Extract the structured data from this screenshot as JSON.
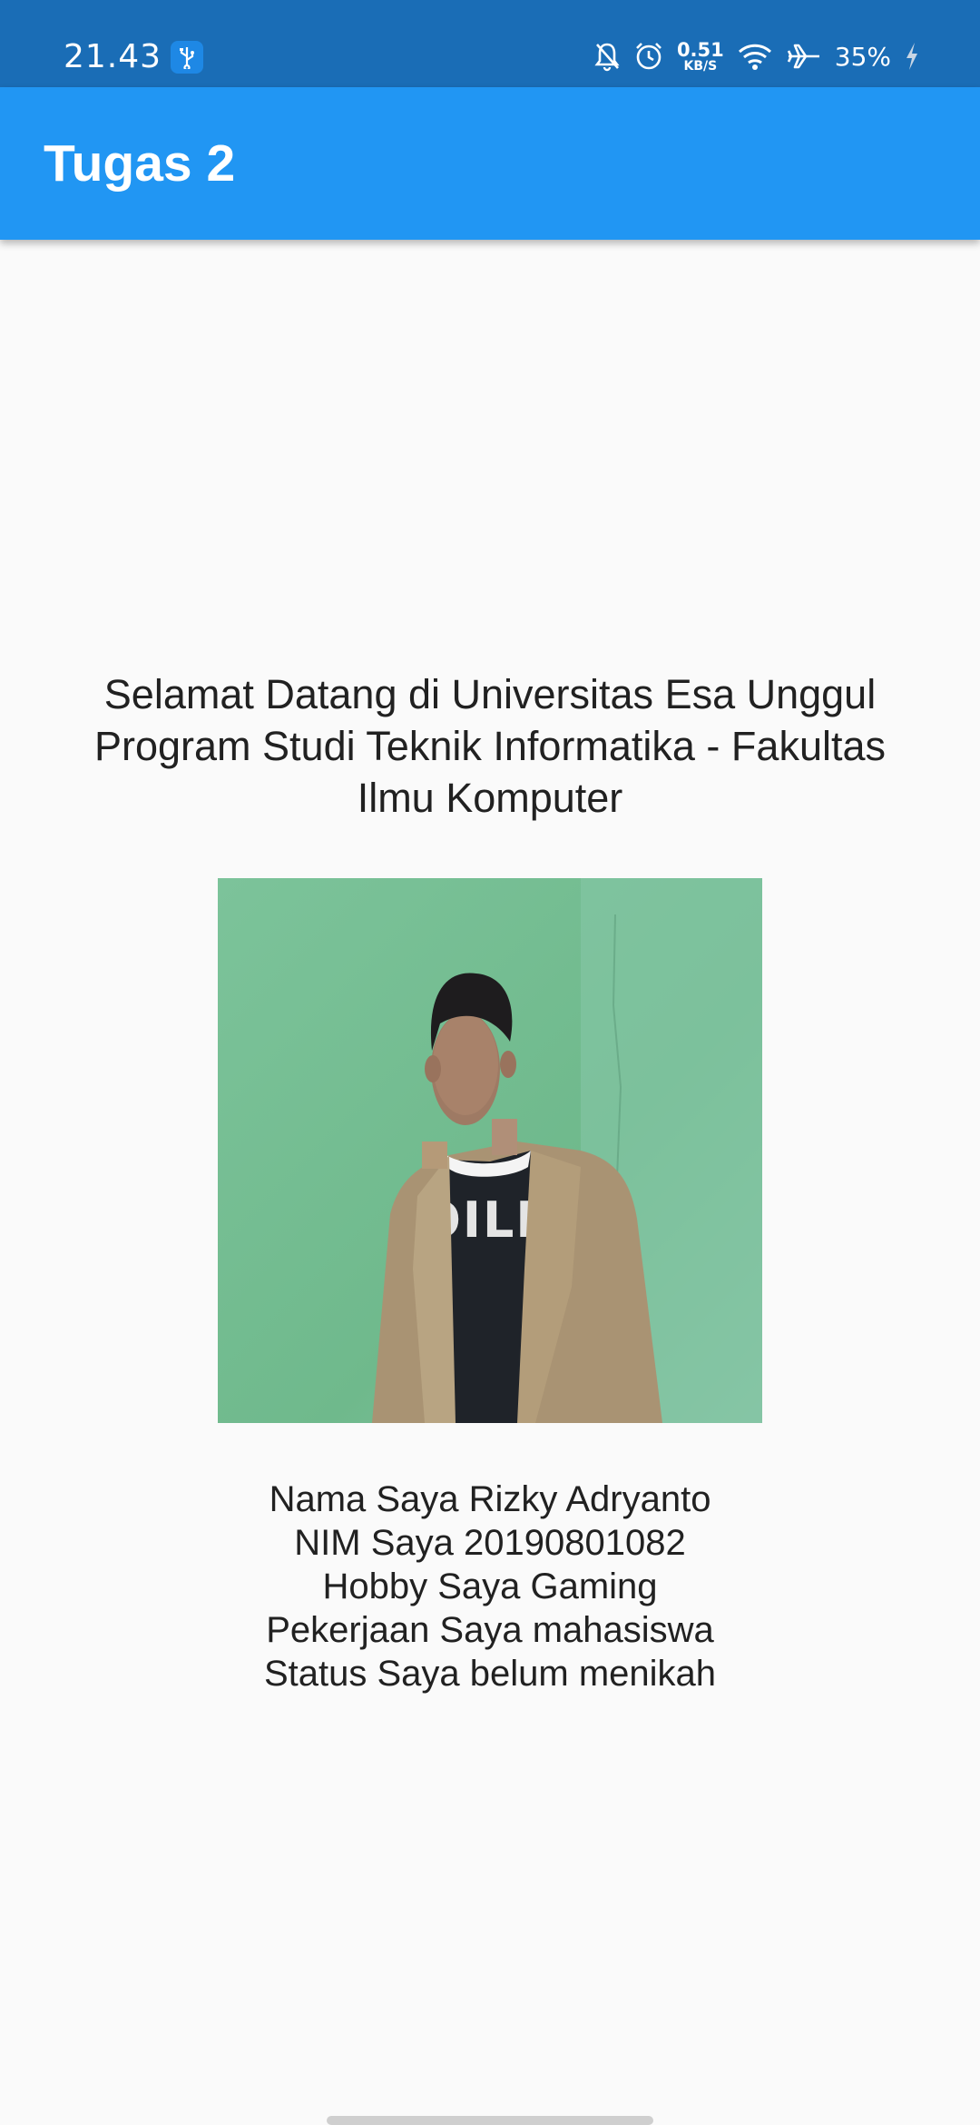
{
  "status_bar": {
    "time": "21.43",
    "net_speed_value": "0.51",
    "net_speed_unit": "KB/S",
    "battery": "35%",
    "icons": [
      "usb-icon",
      "bell-off-icon",
      "alarm-icon",
      "wifi-icon",
      "airplane-icon",
      "charging-icon"
    ]
  },
  "app_bar": {
    "title": "Tugas 2",
    "color": "#2196f3"
  },
  "welcome": {
    "line1": "Selamat Datang di Universitas Esa Unggul",
    "line2": "Program Studi Teknik Informatika - Fakultas",
    "line3": "Ilmu Komputer"
  },
  "profile": {
    "photo_icon": "profile-photo",
    "name_line": "Nama Saya Rizky Adryanto",
    "nim_line": "NIM Saya 20190801082",
    "hobby_line": "Hobby Saya Gaming",
    "job_line": "Pekerjaan Saya mahasiswa",
    "status_line": "Status Saya belum menikah"
  }
}
